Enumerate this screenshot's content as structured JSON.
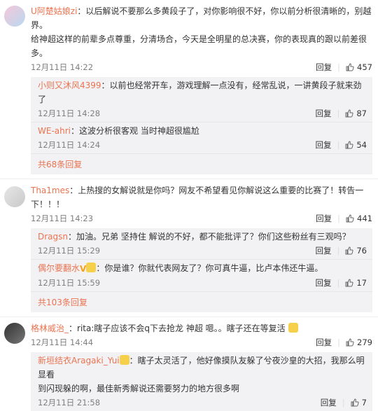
{
  "comments": [
    {
      "name": "U阿楚姑娘zi",
      "text_line1": "：以后解说不要那么多黄段子了，对你影响很不好，你以前分析很清晰的，别越界。",
      "text_line2": "给神超这样的前辈多点尊重，分清场合，今天是全明星的总决赛，你的表现真的跟以前差很多。",
      "time": "12月11日 14:22",
      "reply": "回复",
      "likes": "457",
      "replies": [
        {
          "name": "小则又沐风4399",
          "text": "：以前也经常开车，游戏理解一点没有，经常乱说，一讲黄段子就来劲了",
          "time": "12月11日 14:28",
          "reply": "回复",
          "likes": "87"
        },
        {
          "name": "WE-ahri",
          "text": "：这波分析很客观 当时神超很尴尬",
          "time": "12月11日 14:24",
          "reply": "回复",
          "likes": "54"
        }
      ],
      "more": "共68条回复"
    },
    {
      "name": "Tha1mes",
      "text_line1": "：上热搜的女解说就是你吗？网友不希望看见你解说这么重要的比赛了！转告一",
      "text_line2": "下！！！",
      "time": "12月11日 14:23",
      "reply": "回复",
      "likes": "441",
      "replies": [
        {
          "name": "Dragsn",
          "text": "：加油。兄弟 坚持住 解说的不好，都不能批评了？你们这些粉丝有三观吗？",
          "time": "12月11日 15:29",
          "reply": "回复",
          "likes": "76"
        },
        {
          "name": "偶尔要翻水",
          "text": "：你是谁？你就代表网友了？你可真牛逼，比卢本伟还牛逼。",
          "time": "12月11日 15:59",
          "reply": "回复",
          "likes": "17"
        }
      ],
      "more": "共103条回复"
    },
    {
      "name": "格林威治_",
      "text_line1": "：rita:瞎子应该不会q下去抢龙 神超 嗯。。瞎子还在等复活",
      "time": "12月11日 14:44",
      "reply": "回复",
      "likes": "279",
      "replies": [
        {
          "name": "新垣结衣Aragaki_Yui",
          "text_line1": "：瞎子太灵活了，他好像摸队友躲了兮夜沙皇的大招，我那么明显看",
          "text_line2": "到闪现躲的啊，最佳新秀解说还需要努力的地方很多啊",
          "time": "12月11日 21:58",
          "reply": "回复",
          "likes": "7"
        }
      ]
    }
  ],
  "colors": {
    "accent": "#eb7350",
    "subbg": "#f2f2f5"
  }
}
